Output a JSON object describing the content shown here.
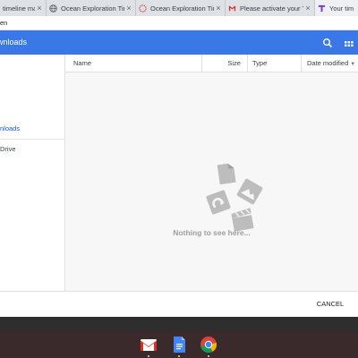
{
  "browser": {
    "tabs": [
      {
        "title": "timeline mak",
        "favicon": "timeline-icon"
      },
      {
        "title": "Ocean Exploration Time",
        "favicon": "globe-icon"
      },
      {
        "title": "Ocean Exploration Time",
        "favicon": "loading-icon"
      },
      {
        "title": "Please activate your Tin",
        "favicon": "gmail-icon"
      },
      {
        "title": "Your tim",
        "favicon": "timetoast-icon"
      }
    ],
    "close_glyph": "×",
    "address_text": "en"
  },
  "dialog": {
    "title": "wnloads",
    "nav": {
      "downloads_label": "nloads",
      "drive_label": "Drive"
    },
    "columns": {
      "name": "Name",
      "size": "Size",
      "type": "Type",
      "date": "Date modified",
      "sort_glyph": "▼"
    },
    "empty_message": "Nothing to see here...",
    "cancel_label": "CANCEL"
  },
  "shelf": {
    "apps": [
      "gmail-icon",
      "docs-icon",
      "chrome-icon"
    ]
  },
  "colors": {
    "header_blue": "#3b78e7",
    "nav_selected": "#1a56c9",
    "empty_gray": "#9e9e9e"
  }
}
